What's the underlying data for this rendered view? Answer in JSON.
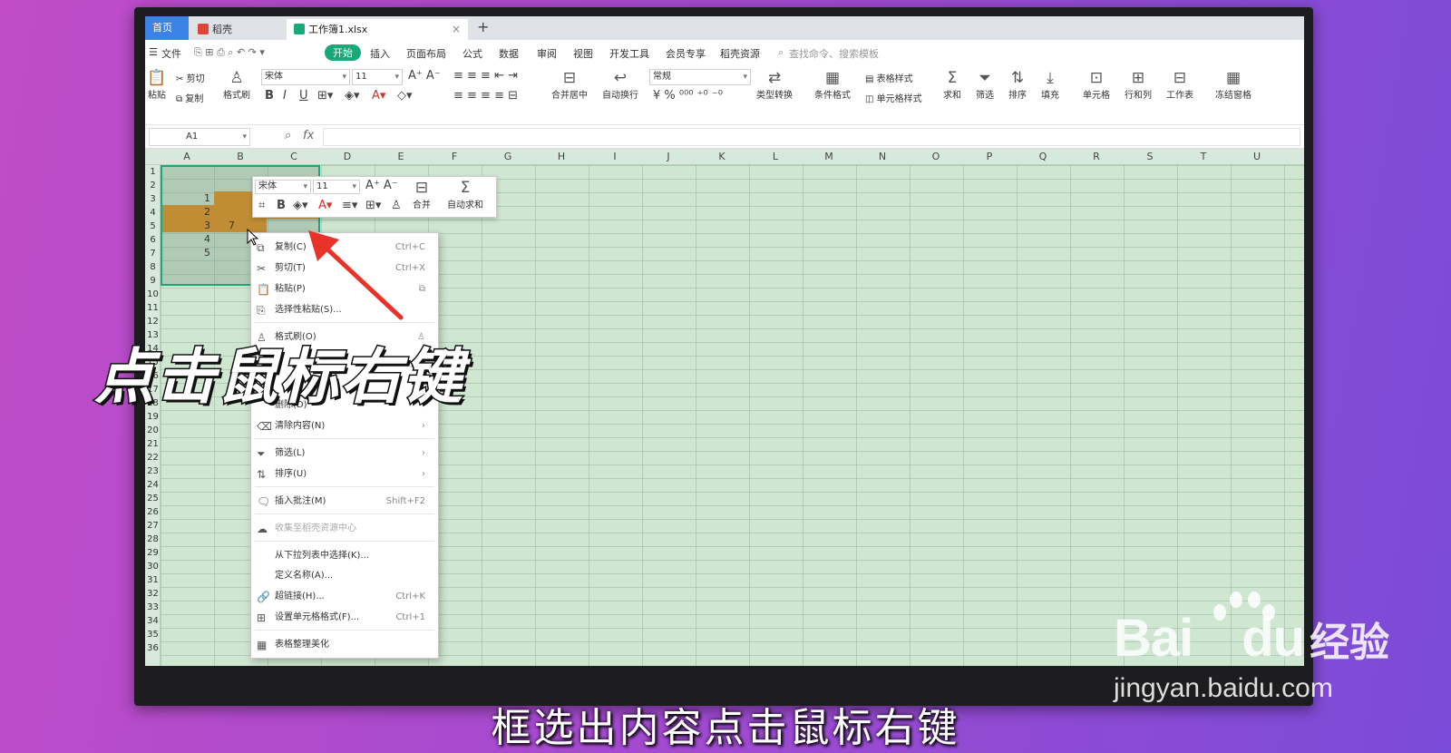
{
  "tabs": {
    "home": "首页",
    "docer": "稻壳",
    "file": "工作簿1.xlsx",
    "close": "×",
    "add": "+"
  },
  "menu": {
    "file": "文件",
    "start": "开始",
    "insert": "插入",
    "layout": "页面布局",
    "formula": "公式",
    "data": "数据",
    "review": "审阅",
    "view": "视图",
    "dev": "开发工具",
    "member": "会员专享",
    "resources": "稻壳资源",
    "search": "查找命令、搜索模板"
  },
  "ribbon": {
    "paste": "粘贴",
    "cut": "剪切",
    "copy": "复制",
    "format_painter": "格式刷",
    "font": "宋体",
    "size": "11",
    "merge": "合并居中",
    "wrap": "自动换行",
    "number_format": "常规",
    "type_convert": "类型转换",
    "cond_format": "条件格式",
    "table_style": "表格样式",
    "cell_style": "单元格样式",
    "sum": "求和",
    "filter": "筛选",
    "sort": "排序",
    "fill": "填充",
    "cell": "单元格",
    "rowcol": "行和列",
    "worksheet": "工作表",
    "freeze": "冻结窗格"
  },
  "formula_bar": {
    "namebox": "A1",
    "fx": "fx"
  },
  "columns": [
    "A",
    "B",
    "C",
    "D",
    "E",
    "F",
    "G",
    "H",
    "I",
    "J",
    "K",
    "L",
    "M",
    "N",
    "O",
    "P",
    "Q",
    "R",
    "S",
    "T",
    "U"
  ],
  "rows": [
    "1",
    "2",
    "3",
    "4",
    "5",
    "6",
    "7",
    "8",
    "9",
    "10",
    "11",
    "12",
    "13",
    "14",
    "15",
    "16",
    "17",
    "18",
    "19",
    "20",
    "21",
    "22",
    "23",
    "24",
    "25",
    "26",
    "27",
    "28",
    "29",
    "30",
    "31",
    "32",
    "33",
    "34",
    "35",
    "36"
  ],
  "cells": {
    "a2": "1",
    "a3": "2",
    "a4": "3",
    "a5": "4",
    "a6": "5",
    "c7": "7"
  },
  "mini_toolbar": {
    "font": "宋体",
    "size": "11",
    "merge": "合并",
    "autosum": "自动求和"
  },
  "context_menu": {
    "copy": "复制(C)",
    "copy_sc": "Ctrl+C",
    "cut": "剪切(T)",
    "cut_sc": "Ctrl+X",
    "paste": "粘贴(P)",
    "paste_special": "选择性粘贴(S)...",
    "format_painter": "格式刷(O)",
    "delete": "删除(D)",
    "clear": "清除内容(N)",
    "filter": "筛选(L)",
    "sort": "排序(U)",
    "comment": "插入批注(M)",
    "comment_sc": "Shift+F2",
    "collect": "收集至稻壳资源中心",
    "pick_list": "从下拉列表中选择(K)...",
    "define_name": "定义名称(A)...",
    "hyperlink": "超链接(H)...",
    "hyperlink_sc": "Ctrl+K",
    "format_cells": "设置单元格格式(F)...",
    "format_cells_sc": "Ctrl+1",
    "beautify": "表格整理美化"
  },
  "overlay": {
    "big": "点击鼠标右键",
    "subtitle": "框选出内容点击鼠标右键"
  },
  "watermark": {
    "logo": "Bai",
    "logo_du": "du",
    "cn": "经验",
    "url": "jingyan.baidu.com"
  },
  "colors": {
    "accent": "#1aa77a",
    "highlight": "#e8890c",
    "arrow": "#e8332a",
    "grid_bg": "#cfe6d1"
  }
}
